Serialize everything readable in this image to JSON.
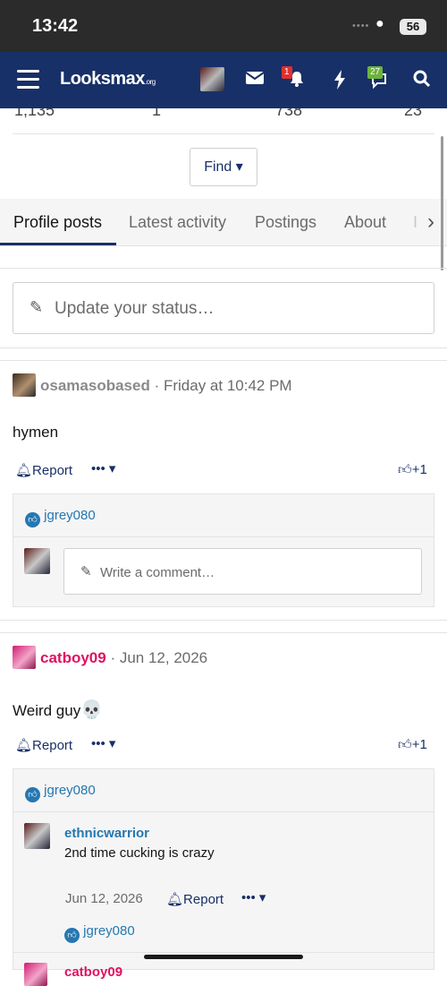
{
  "status_bar": {
    "time": "13:42",
    "battery": "56"
  },
  "navbar": {
    "logo_main": "Looksmax",
    "logo_sub": ".org",
    "alerts_badge": "1",
    "conversations_badge": "27"
  },
  "stats": [
    "1,135",
    "1",
    "738",
    "23"
  ],
  "find_button": "Find",
  "tabs": [
    "Profile posts",
    "Latest activity",
    "Postings",
    "About",
    "I"
  ],
  "status_placeholder": "Update your status…",
  "posts": [
    {
      "user": "osamasobased",
      "time": "Friday at 10:42 PM",
      "body": "hymen",
      "report": "Report",
      "like_count": "+1",
      "reaction_user": "jgrey080",
      "comment_placeholder": "Write a comment…"
    },
    {
      "user": "catboy09",
      "time": "Jun 12, 2026",
      "body": "Weird guy",
      "report": "Report",
      "like_count": "+1",
      "reaction_user": "jgrey080",
      "comment": {
        "user": "ethnicwarrior",
        "text": "2nd time cucking is crazy",
        "time": "Jun 12, 2026",
        "report": "Report",
        "reaction_user": "jgrey080"
      },
      "next_user_partial": "catboy09"
    }
  ],
  "colors": {
    "nav": "#183068",
    "accent": "#2577b1",
    "pink_user": "#e0115f"
  }
}
